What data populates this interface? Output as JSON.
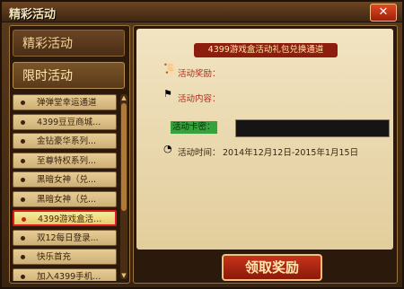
{
  "window": {
    "title": "精彩活动",
    "close": "✕"
  },
  "left": {
    "categories": [
      "精彩活动",
      "限时活动"
    ],
    "items": [
      "弹弹堂幸运通道",
      "4399豆豆商城...",
      "金钻豪华系列...",
      "至尊特权系列...",
      "黑暗女神（兑...",
      "黑暗女神（兑...",
      "4399游戏盒活...",
      "双12每日登录...",
      "快乐首充",
      "加入4399手机..."
    ],
    "selected_index": 6
  },
  "right": {
    "banner": "4399游戏盒活动礼包兑换通道",
    "reward_label": "活动奖励：",
    "content_label": "活动内容：",
    "code_label": "活动卡密：",
    "time_label": "活动时间：",
    "time_value": "2014年12月12日-2015年1月15日",
    "button": "领取奖励"
  },
  "icons": {
    "reward": "scroll-icon",
    "content": "flag-icon",
    "time": "clock-icon"
  }
}
